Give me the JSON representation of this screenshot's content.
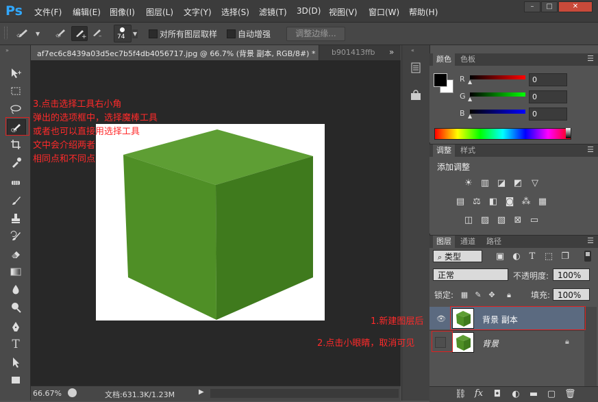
{
  "app": {
    "logo": "Ps"
  },
  "menu": [
    "文件(F)",
    "编辑(E)",
    "图像(I)",
    "图层(L)",
    "文字(Y)",
    "选择(S)",
    "滤镜(T)",
    "3D(D)",
    "视图(V)",
    "窗口(W)",
    "帮助(H)"
  ],
  "window_buttons": {
    "minimize": "–",
    "restore": "□",
    "close": "✕"
  },
  "options": {
    "brush_size": "74",
    "sample_all_layers": "对所有图层取样",
    "auto_enhance": "自动增强",
    "refine_edge": "调整边缘..."
  },
  "document": {
    "active_tab": "af7ec6c8439a03d5ec7b5f4db4056717.jpg @ 66.7% (背景 副本, RGB/8#) *",
    "second_tab": "b901413ffb",
    "overflow_tabs": "»"
  },
  "status": {
    "zoom": "66.67%",
    "doc_size": "文档:631.3K/1.23M"
  },
  "color_panel": {
    "tabs": [
      "颜色",
      "色板"
    ],
    "channels": [
      {
        "label": "R",
        "value": "0"
      },
      {
        "label": "G",
        "value": "0"
      },
      {
        "label": "B",
        "value": "0"
      }
    ]
  },
  "adjust_panel": {
    "tabs": [
      "调整",
      "样式"
    ],
    "title": "添加调整"
  },
  "layers_panel": {
    "tabs": [
      "图层",
      "通道",
      "路径"
    ],
    "filter_type": "类型",
    "blend_mode": "正常",
    "opacity_label": "不透明度:",
    "opacity_value": "100%",
    "lock_label": "锁定:",
    "fill_label": "填充:",
    "fill_value": "100%",
    "layers": [
      {
        "name": "背景 副本",
        "visible": true,
        "selected": true
      },
      {
        "name": "背景",
        "visible": false,
        "selected": false
      }
    ]
  },
  "annotations": {
    "step3_lines": [
      "3.点击选择工具右小角",
      "弹出的选项框中，选择魔棒工具",
      "或者也可以直接用选择工具",
      "文中会介绍两者",
      "相同点和不同点"
    ],
    "step1": "1.新建图层后",
    "step2": "2.点击小眼睛，取消可见"
  },
  "colors": {
    "bg": "#535353",
    "canvas": "#282828",
    "annotation": "#ff2a2a",
    "cube_front": "#4f8f26",
    "cube_side": "#3f7a1d",
    "cube_top": "#5e9e34"
  }
}
